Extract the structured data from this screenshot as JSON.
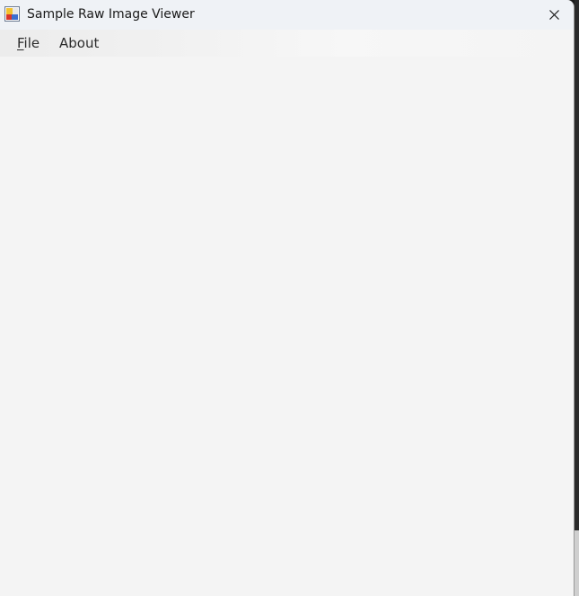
{
  "window": {
    "title": "Sample Raw Image Viewer",
    "icon": "app-window-icon",
    "close_icon": "close-icon"
  },
  "menu": {
    "file": {
      "mnemonic": "F",
      "rest": "ile"
    },
    "about": {
      "label": "About"
    }
  },
  "colors": {
    "titlebar": "#eff2f6",
    "client": "#f4f4f4",
    "text": "#1a1a1a"
  }
}
